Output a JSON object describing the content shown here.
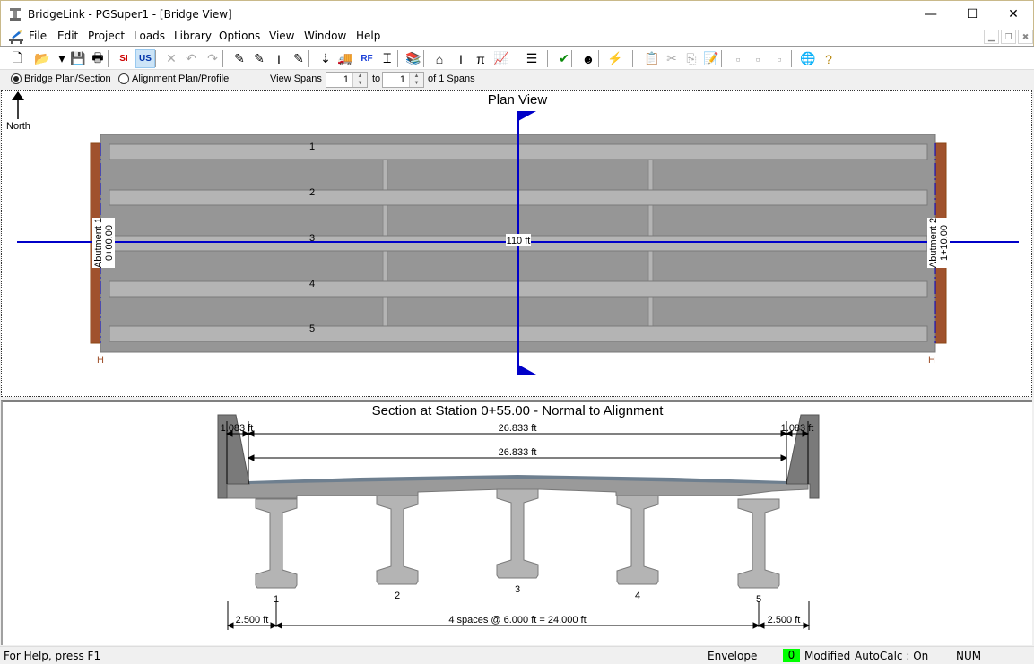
{
  "window": {
    "title": "BridgeLink - PGSuper1 - [Bridge View]",
    "controls": {
      "minimize": "—",
      "maximize": "☐",
      "close": "✕"
    },
    "mdi_controls": {
      "minimize": "▁",
      "restore": "❐",
      "close": "✖"
    }
  },
  "menu": {
    "items": [
      {
        "label": "File",
        "accel": "F"
      },
      {
        "label": "Edit",
        "accel": "E"
      },
      {
        "label": "Project",
        "accel": "P"
      },
      {
        "label": "Loads",
        "accel": "o"
      },
      {
        "label": "Library",
        "accel": "b"
      },
      {
        "label": "Options",
        "accel": "O"
      },
      {
        "label": "View",
        "accel": "V"
      },
      {
        "label": "Window",
        "accel": "W"
      },
      {
        "label": "Help",
        "accel": "H"
      }
    ]
  },
  "toolbar": {
    "buttons": [
      {
        "name": "new-document-icon",
        "glyph": "🗋"
      },
      {
        "name": "open-folder-icon",
        "glyph": "📂"
      },
      {
        "name": "dropdown-arrow-icon",
        "glyph": "▾"
      },
      {
        "name": "save-icon",
        "glyph": "💾"
      },
      {
        "name": "print-icon",
        "glyph": "🖶"
      },
      {
        "name": "si-units-icon",
        "glyph": "SI"
      },
      {
        "name": "us-units-icon",
        "glyph": "US",
        "active": true
      },
      {
        "name": "delete-icon",
        "glyph": "✕"
      },
      {
        "name": "undo-icon",
        "glyph": "↶"
      },
      {
        "name": "redo-icon",
        "glyph": "↷"
      },
      {
        "name": "edit-alignment-icon",
        "glyph": "✎"
      },
      {
        "name": "edit-deck-icon",
        "glyph": "✎"
      },
      {
        "name": "edit-girder-icon",
        "glyph": "I"
      },
      {
        "name": "edit-pier-icon",
        "glyph": "✎"
      },
      {
        "name": "edit-loads-icon",
        "glyph": "⇣"
      },
      {
        "name": "live-load-truck-icon",
        "glyph": "🚚"
      },
      {
        "name": "rating-factor-icon",
        "glyph": "RF"
      },
      {
        "name": "girder-design-icon",
        "glyph": "Ꮖ"
      },
      {
        "name": "library-books-icon",
        "glyph": "📚"
      },
      {
        "name": "deck-section-icon",
        "glyph": "⌂"
      },
      {
        "name": "girder-section-icon",
        "glyph": "I"
      },
      {
        "name": "pier-section-icon",
        "glyph": "π"
      },
      {
        "name": "graph-icon",
        "glyph": "📈"
      },
      {
        "name": "report-icon",
        "glyph": "☰"
      },
      {
        "name": "check-icon",
        "glyph": "✔"
      },
      {
        "name": "engineer-icon",
        "glyph": "☻"
      },
      {
        "name": "lightning-icon",
        "glyph": "⚡"
      },
      {
        "name": "paste-special-icon",
        "glyph": "📋"
      },
      {
        "name": "cut-icon",
        "glyph": "✂"
      },
      {
        "name": "copy-icon",
        "glyph": "⎘"
      },
      {
        "name": "edit-note-icon",
        "glyph": "📝"
      },
      {
        "name": "layout-1-icon",
        "glyph": "▫"
      },
      {
        "name": "layout-2-icon",
        "glyph": "▫"
      },
      {
        "name": "layout-3-icon",
        "glyph": "▫"
      },
      {
        "name": "globe-icon",
        "glyph": "🌐"
      },
      {
        "name": "help-icon",
        "glyph": "?"
      }
    ]
  },
  "viewbar": {
    "options": [
      {
        "label": "Bridge Plan/Section",
        "selected": true
      },
      {
        "label": "Alignment Plan/Profile",
        "selected": false
      }
    ],
    "view_spans_label": "View Spans",
    "span_from": "1",
    "to_label": "to",
    "span_to": "1",
    "of_label": "of 1 Spans"
  },
  "plan_view": {
    "title": "Plan View",
    "north_label": "North",
    "span_length_label": "110 ft",
    "girder_labels": [
      "1",
      "2",
      "3",
      "4",
      "5"
    ],
    "abutment_1": {
      "name": "Abutment 1",
      "station": "0+00.00"
    },
    "abutment_2": {
      "name": "Abutment 2",
      "station": "1+10.00"
    },
    "bearing_marker": "H"
  },
  "section_view": {
    "title": "Section at Station 0+55.00 - Normal to Alignment",
    "barrier_width": "1.083 ft",
    "roadway_width_top": "26.833 ft",
    "roadway_width_bottom": "26.833 ft",
    "girder_labels": [
      "1",
      "2",
      "3",
      "4",
      "5"
    ],
    "overhang_left": "2.500 ft",
    "spacing": "4 spaces @ 6.000 ft = 24.000 ft",
    "overhang_right": "2.500 ft"
  },
  "statusbar": {
    "help": "For Help, press F1",
    "mode": "Envelope",
    "count": "0",
    "modified": "Modified",
    "autocalc": "AutoCalc : On",
    "num": "NUM"
  },
  "colors": {
    "alignment_blue": "#0000c8",
    "abutment_brown": "#a0522d",
    "deck_gray": "#969696",
    "girder_gray": "#b4b4b4",
    "status_green": "#00ff00"
  }
}
